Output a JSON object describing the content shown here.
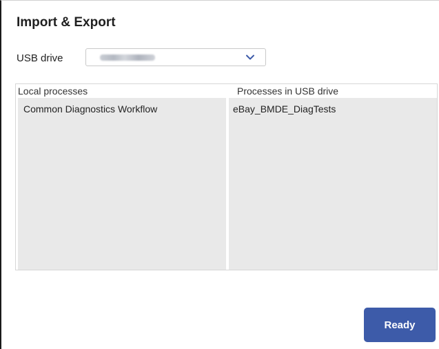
{
  "dialog": {
    "title": "Import & Export"
  },
  "usb": {
    "label": "USB drive",
    "selected_value_obscured": true,
    "dropdown_icon": "chevron-down-icon"
  },
  "columns": {
    "local": {
      "header": "Local processes",
      "items": [
        "Common Diagnostics Workflow"
      ]
    },
    "usb": {
      "header": "Processes in USB drive",
      "items": [
        "eBay_BMDE_DiagTests"
      ]
    }
  },
  "actions": {
    "ready_label": "Ready"
  },
  "colors": {
    "accent": "#3d5ba9",
    "list_background": "#e9e9e9",
    "chevron": "#3d5ba9"
  }
}
